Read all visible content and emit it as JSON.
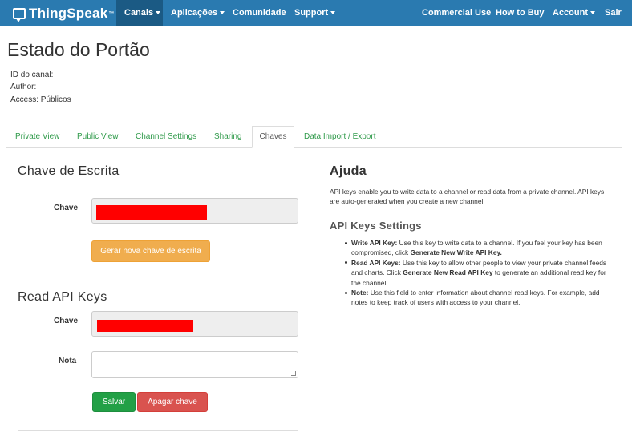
{
  "navbar": {
    "brand": "ThingSpeak",
    "brand_tm": "™",
    "items": [
      {
        "label": "Canais",
        "dropdown": true,
        "active": true
      },
      {
        "label": "Aplicações",
        "dropdown": true
      },
      {
        "label": "Comunidade",
        "dropdown": false
      },
      {
        "label": "Support",
        "dropdown": true
      }
    ],
    "right_items": [
      {
        "label": "Commercial Use",
        "dropdown": false
      },
      {
        "label": "How to Buy",
        "dropdown": false
      },
      {
        "label": "Account",
        "dropdown": true
      },
      {
        "label": "Sair",
        "dropdown": false
      }
    ]
  },
  "channel": {
    "title": "Estado do Portão",
    "id_label": "ID do canal:",
    "author_label": "Author:",
    "access_label": "Access:",
    "access_value": "Públicos"
  },
  "tabs": [
    {
      "label": "Private View"
    },
    {
      "label": "Public View"
    },
    {
      "label": "Channel Settings"
    },
    {
      "label": "Sharing"
    },
    {
      "label": "Chaves",
      "active": true
    },
    {
      "label": "Data Import / Export"
    }
  ],
  "write_key": {
    "title": "Chave de Escrita",
    "key_label": "Chave",
    "generate_button": "Gerar nova chave de escrita"
  },
  "read_keys": {
    "title": "Read API Keys",
    "key_label": "Chave",
    "note_label": "Nota",
    "save_button": "Salvar",
    "delete_button": "Apagar chave"
  },
  "help": {
    "title": "Ajuda",
    "intro": "API keys enable you to write data to a channel or read data from a private channel. API keys are auto-generated when you create a new channel.",
    "settings_title": "API Keys Settings",
    "items": [
      {
        "term": "Write API Key:",
        "text_before": " Use this key to write data to a channel. If you feel your key has been compromised, click ",
        "action": "Generate New Write API Key.",
        "text_after": ""
      },
      {
        "term": "Read API Keys:",
        "text_before": " Use this key to allow other people to view your private channel feeds and charts. Click ",
        "action": "Generate New Read API Key",
        "text_after": " to generate an additional read key for the channel."
      },
      {
        "term": "Note:",
        "text_before": " Use this field to enter information about channel read keys. For example, add notes to keep track of users with access to your channel.",
        "action": "",
        "text_after": ""
      }
    ]
  },
  "colors": {
    "navbar": "#2a7ab0",
    "navbar_active": "#1b5a84",
    "tab_link": "#2f9a4a",
    "warning": "#f0ad4e",
    "success": "#22a046",
    "danger": "#d9534f",
    "redaction": "#ff0000"
  }
}
